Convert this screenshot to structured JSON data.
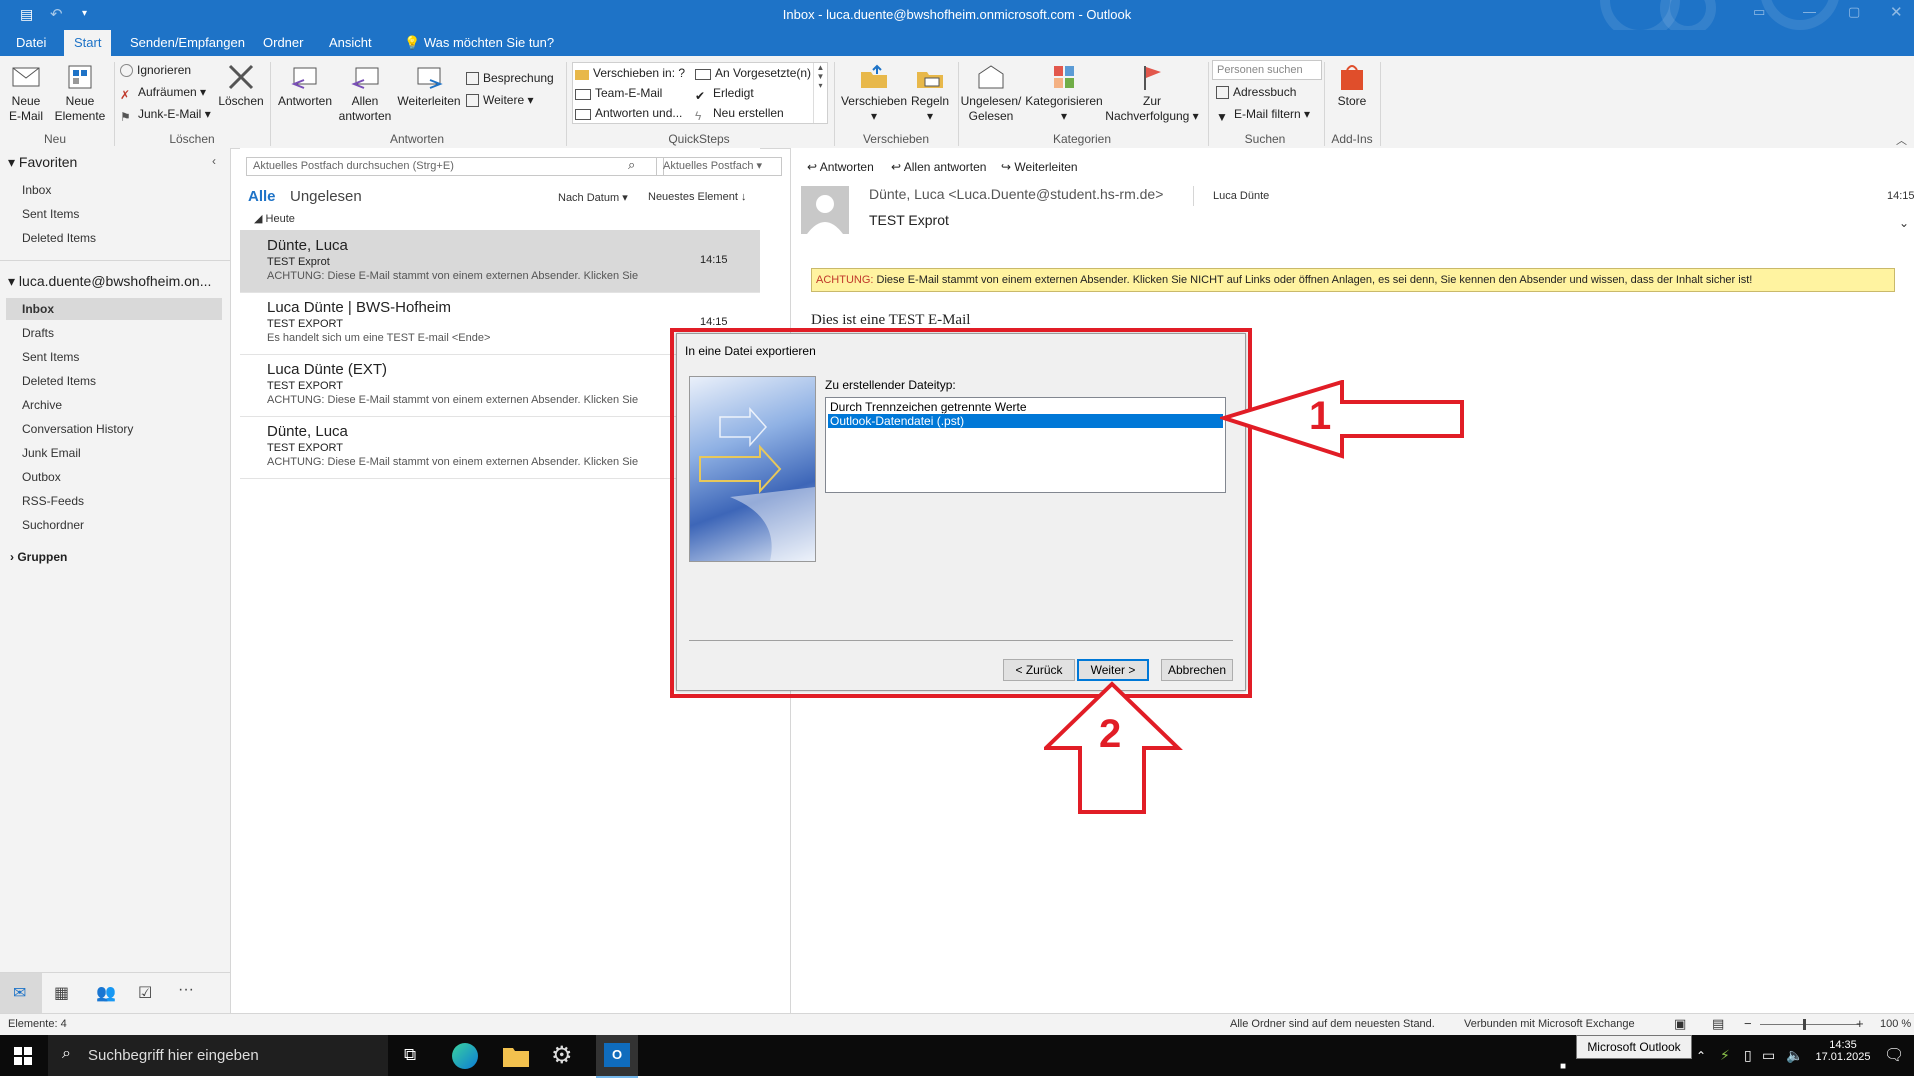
{
  "window": {
    "title": "Inbox - luca.duente@bwshofheim.onmicrosoft.com - Outlook"
  },
  "tabs": [
    "Datei",
    "Start",
    "Senden/Empfangen",
    "Ordner",
    "Ansicht"
  ],
  "tell_me": "Was möchten Sie tun?",
  "ribbon": {
    "new_email": "Neue E-Mail",
    "new_items": "Neue Elemente",
    "group_new": "Neu",
    "ignore": "Ignorieren",
    "cleanup": "Aufräumen",
    "junk": "Junk-E-Mail",
    "delete": "Löschen",
    "group_delete": "Löschen",
    "reply": "Antworten",
    "reply_all": "Allen antworten",
    "forward": "Weiterleiten",
    "meeting": "Besprechung",
    "more": "Weitere",
    "group_respond": "Antworten",
    "qs_move": "Verschieben in: ?",
    "qs_team": "Team-E-Mail",
    "qs_reply_delete": "Antworten und...",
    "qs_manager": "An Vorgesetzte(n)",
    "qs_done": "Erledigt",
    "qs_new": "Neu erstellen",
    "group_quicksteps": "QuickSteps",
    "move": "Verschieben",
    "rules": "Regeln",
    "group_move": "Verschieben",
    "unread": "Ungelesen/ Gelesen",
    "categorize": "Kategorisieren",
    "followup": "Zur Nachverfolgung",
    "group_tags": "Kategorien",
    "people_search": "Personen suchen",
    "address_book": "Adressbuch",
    "filter": "E-Mail filtern",
    "group_find": "Suchen",
    "store": "Store",
    "group_addins": "Add-Ins"
  },
  "nav": {
    "favorites": "Favoriten",
    "fav_items": [
      "Inbox",
      "Sent Items",
      "Deleted Items"
    ],
    "account": "luca.duente@bwshofheim.on...",
    "folders": [
      "Inbox",
      "Drafts",
      "Sent Items",
      "Deleted Items",
      "Archive",
      "Conversation History",
      "Junk Email",
      "Outbox",
      "RSS-Feeds",
      "Suchordner"
    ],
    "groups": "Gruppen"
  },
  "search": {
    "placeholder": "Aktuelles Postfach durchsuchen (Strg+E)",
    "scope": "Aktuelles Postfach"
  },
  "filter": {
    "all": "Alle",
    "unread": "Ungelesen",
    "sort": "Nach Datum",
    "order": "Neuestes Element"
  },
  "group_header": "Heute",
  "mails": [
    {
      "from": "Dünte, Luca",
      "subject": "TEST Exprot",
      "preview": "ACHTUNG: Diese E-Mail stammt von einem externen Absender. Klicken Sie",
      "time": "14:15"
    },
    {
      "from": "Luca Dünte | BWS-Hofheim",
      "subject": "TEST EXPORT",
      "preview": "Es handelt sich um eine TEST E-mail <Ende>",
      "time": "14:15"
    },
    {
      "from": "Luca Dünte (EXT)",
      "subject": "TEST EXPORT",
      "preview": "ACHTUNG: Diese E-Mail stammt von einem externen Absender. Klicken Sie",
      "time": ""
    },
    {
      "from": "Dünte, Luca",
      "subject": "TEST EXPORT",
      "preview": "ACHTUNG: Diese E-Mail stammt von einem externen Absender. Klicken Sie",
      "time": ""
    }
  ],
  "reading": {
    "reply": "Antworten",
    "reply_all": "Allen antworten",
    "forward": "Weiterleiten",
    "sender": "Dünte, Luca <Luca.Duente@student.hs-rm.de>",
    "to": "Luca Dünte",
    "time": "14:15",
    "subject": "TEST Exprot",
    "warning_label": "ACHTUNG:",
    "warning_text": "Diese E-Mail stammt von einem externen Absender. Klicken Sie NICHT auf Links oder öffnen Anlagen, es sei denn, Sie kennen den Absender und wissen, dass der Inhalt sicher ist!",
    "body": "Dies ist eine TEST E-Mail"
  },
  "dialog": {
    "title": "In eine Datei exportieren",
    "label": "Zu erstellender Dateityp:",
    "options": [
      "Durch Trennzeichen getrennte Werte",
      "Outlook-Datendatei (.pst)"
    ],
    "selected_index": 1,
    "back": "< Zurück",
    "next": "Weiter >",
    "cancel": "Abbrechen"
  },
  "annotations": {
    "one": "1",
    "two": "2"
  },
  "status": {
    "items": "Elemente: 4",
    "sync": "Alle Ordner sind auf dem neuesten Stand.",
    "connected": "Verbunden mit Microsoft Exchange",
    "zoom": "100 %"
  },
  "taskbar": {
    "search": "Suchbegriff hier eingeben",
    "tooltip": "Microsoft Outlook",
    "time": "14:35",
    "date": "17.01.2025"
  },
  "colors": {
    "accent": "#1e73c7",
    "annotation": "#e11d26",
    "warning_bg": "#fff3a0"
  }
}
